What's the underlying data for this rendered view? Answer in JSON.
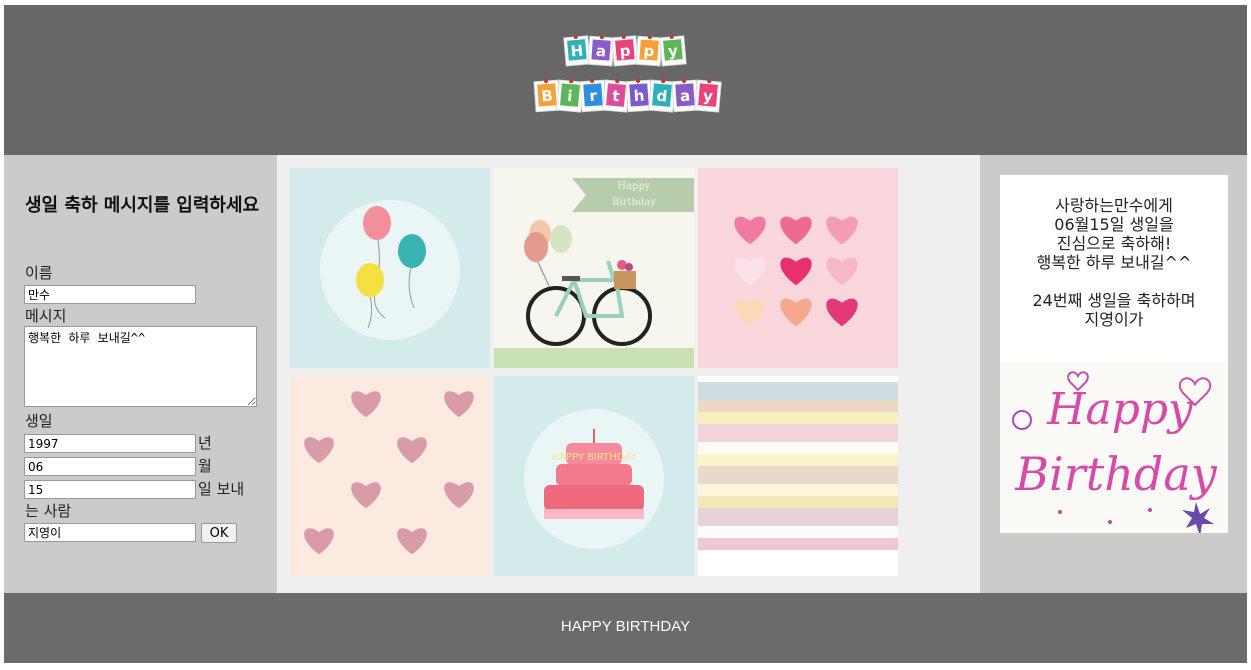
{
  "header": {
    "logo_row1": [
      "H",
      "a",
      "p",
      "p",
      "y"
    ],
    "logo_row2": [
      "B",
      "i",
      "r",
      "t",
      "h",
      "d",
      "a",
      "y"
    ]
  },
  "form": {
    "title": "생일 축하 메시지를 입력하세요",
    "name_label": "이름",
    "name_value": "만수",
    "message_label": "메시지",
    "message_value": "행복한 하루 보내길^^",
    "birthday_label": "생일",
    "year_value": "1997",
    "year_suffix": "년",
    "month_value": "06",
    "month_suffix": "월",
    "day_value": "15",
    "day_suffix": "일 보내",
    "sender_label": "는 사람",
    "sender_value": "지영이",
    "ok_label": "OK"
  },
  "gallery": {
    "tiles": [
      {
        "name": "balloons"
      },
      {
        "name": "bicycle",
        "banner_text": [
          "Happy",
          "Birthday"
        ]
      },
      {
        "name": "hearts-grid"
      },
      {
        "name": "hearts-pattern"
      },
      {
        "name": "cake",
        "cake_text": "HAPPY BIRTHDAY"
      },
      {
        "name": "stripes"
      }
    ]
  },
  "card": {
    "lines": [
      "사랑하는만수에게",
      "06월15일 생일을",
      "진심으로 축하해!",
      "행복한 하루 보내길^^",
      "",
      "24번째 생일을 축하하며",
      "지영이가"
    ],
    "image_text": [
      "Happy",
      "Birthday"
    ]
  },
  "footer": {
    "text": "HAPPY BIRTHDAY"
  },
  "colors": {
    "header_bg": "#676767",
    "panel_bg": "#cbcbcb",
    "gallery_bg": "#efefef",
    "footer_bg": "#6b6b6b"
  }
}
